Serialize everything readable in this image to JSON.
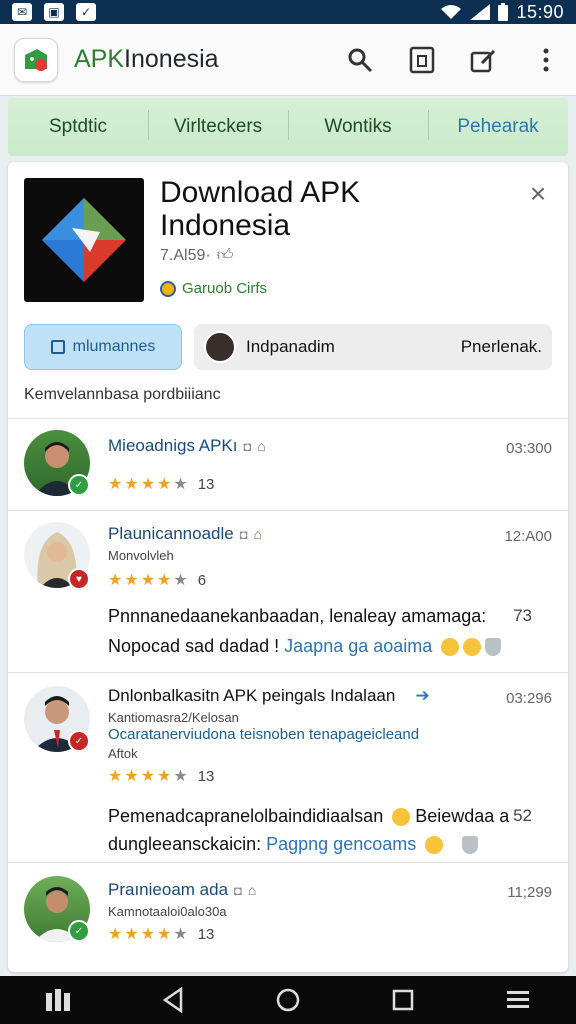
{
  "status_bar": {
    "time": "15:90"
  },
  "app_bar": {
    "title_accent": "APK",
    "title_rest": "Inonesia"
  },
  "tabs": [
    {
      "label": "Sptdtic"
    },
    {
      "label": "Virlteckers"
    },
    {
      "label": "Wontiks"
    },
    {
      "label": "Pehearak"
    }
  ],
  "app": {
    "name": "Download APK Indonesia",
    "meta": "7.Al59·",
    "developer": "Garuob Cirfs"
  },
  "filters": {
    "primary": "mlumannes",
    "user_chip_label": "Indpanadim",
    "user_chip_right": "Pnerlenak."
  },
  "section_label": "Kemvelannbasa pordbiiianc",
  "reviews": [
    {
      "name": "Mieoadnigs APKı",
      "time": "03:300",
      "rating": 4,
      "count": "13"
    },
    {
      "name": "Plaunicannoadle",
      "sub": "Monvolvleh",
      "time": "12:A00",
      "rating": 4,
      "count": "6",
      "body1": "Pnnnanedaanekanbaadan, lenaleay amamaga:",
      "body1_num": "73",
      "body2_text": "Nopocad sad dadad !",
      "body2_link": "Jaapna ga aoaima"
    },
    {
      "name": "Dnlonbalkasitn APK peingals Indalaan",
      "time": "03:296",
      "sub": "Kantiomasra2/Kelosan",
      "sub2": "Ocaratanerviudona teisnoben tenapageicleand",
      "sub3": "Aftok",
      "rating": 4,
      "count": "13",
      "body1": "Pemenadcapranelolbaindidiaalsan",
      "body1_tail": "Beiewdaa a",
      "body1_num": "52",
      "body2_text": "dungleeansckaicin:",
      "body2_link": "Pagpng gencoams"
    },
    {
      "name": "Praınieoam ada",
      "sub": "Kamnotaaloi0alo30a",
      "time": "11;299",
      "rating": 4,
      "count": "13"
    }
  ]
}
